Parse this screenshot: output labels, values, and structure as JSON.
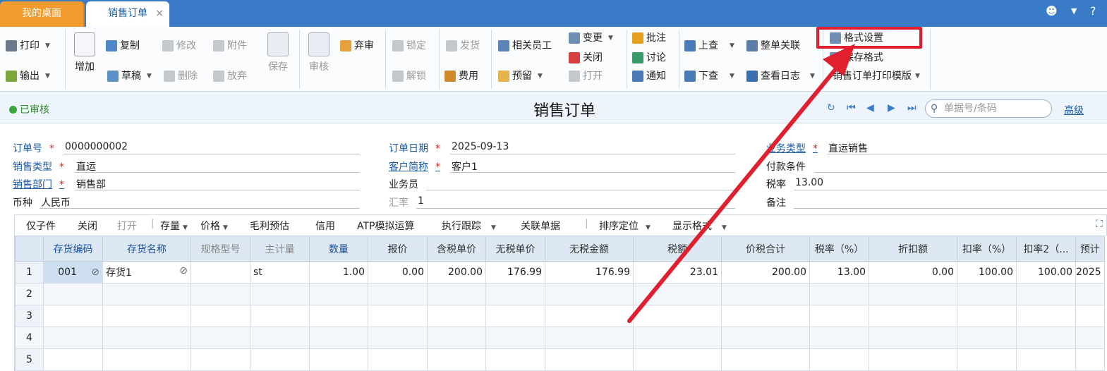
{
  "tabs": {
    "home": "我的桌面",
    "order": "销售订单",
    "close": "×"
  },
  "toolbar": {
    "print": "打印",
    "export": "输出",
    "add": "增加",
    "copy": "复制",
    "draft": "草稿",
    "edit": "修改",
    "delete": "删除",
    "attach": "附件",
    "discard": "放弃",
    "save": "保存",
    "audit": "审核",
    "unaudit": "弃审",
    "lock": "锁定",
    "unlock": "解锁",
    "ship": "发货",
    "cost": "费用",
    "staff": "相关员工",
    "reserve": "预留",
    "change": "变更",
    "close": "关闭",
    "open": "打开",
    "annotate": "批注",
    "discuss": "讨论",
    "notify": "通知",
    "prev": "上查",
    "next": "下查",
    "link": "整单关联",
    "log": "查看日志",
    "format_settings": "格式设置",
    "save_format": "保存格式",
    "print_template": "销售订单打印模版"
  },
  "status": {
    "text": "已审核",
    "title": "销售订单",
    "search_placeholder": "单据号/条码",
    "advanced": "高级"
  },
  "form": {
    "order_no_label": "订单号",
    "order_no": "0000000002",
    "order_date_label": "订单日期",
    "order_date": "2025-09-13",
    "biz_type_label": "业务类型",
    "biz_type": "直运销售",
    "sales_type_label": "销售类型",
    "sales_type": "直运",
    "customer_label": "客户简称",
    "customer": "客户1",
    "payment_label": "付款条件",
    "payment": "",
    "dept_label": "销售部门",
    "dept": "销售部",
    "salesman_label": "业务员",
    "salesman": "",
    "tax_label": "税率",
    "tax": "13.00",
    "currency_label": "币种",
    "currency": "人民币",
    "rate_label": "汇率",
    "rate": "1",
    "remark_label": "备注",
    "remark": ""
  },
  "grid_toolbar": [
    "仅子件",
    "关闭",
    "打开",
    "存量",
    "价格",
    "毛利预估",
    "信用",
    "ATP模拟运算",
    "执行跟踪",
    "关联单据",
    "排序定位",
    "显示格式"
  ],
  "grid": {
    "columns": [
      "存货编码",
      "存货名称",
      "规格型号",
      "主计量",
      "数量",
      "报价",
      "含税单价",
      "无税单价",
      "无税金额",
      "税额",
      "价税合计",
      "税率（%）",
      "折扣额",
      "扣率（%）",
      "扣率2（...",
      "预计"
    ],
    "rows": [
      {
        "n": "1",
        "cells": [
          "001",
          "存货1",
          "",
          "st",
          "1.00",
          "0.00",
          "200.00",
          "176.99",
          "176.99",
          "23.01",
          "200.00",
          "13.00",
          "0.00",
          "100.00",
          "100.00",
          "2025"
        ]
      },
      {
        "n": "2",
        "cells": [
          "",
          "",
          "",
          "",
          "",
          "",
          "",
          "",
          "",
          "",
          "",
          "",
          "",
          "",
          "",
          ""
        ]
      },
      {
        "n": "3",
        "cells": [
          "",
          "",
          "",
          "",
          "",
          "",
          "",
          "",
          "",
          "",
          "",
          "",
          "",
          "",
          "",
          ""
        ]
      },
      {
        "n": "4",
        "cells": [
          "",
          "",
          "",
          "",
          "",
          "",
          "",
          "",
          "",
          "",
          "",
          "",
          "",
          "",
          "",
          ""
        ]
      },
      {
        "n": "5",
        "cells": [
          "",
          "",
          "",
          "",
          "",
          "",
          "",
          "",
          "",
          "",
          "",
          "",
          "",
          "",
          "",
          ""
        ]
      }
    ]
  },
  "colors": {
    "tabbar": "#3a7bc8",
    "home_tab": "#f19a2e",
    "highlight": "#e0202e"
  }
}
